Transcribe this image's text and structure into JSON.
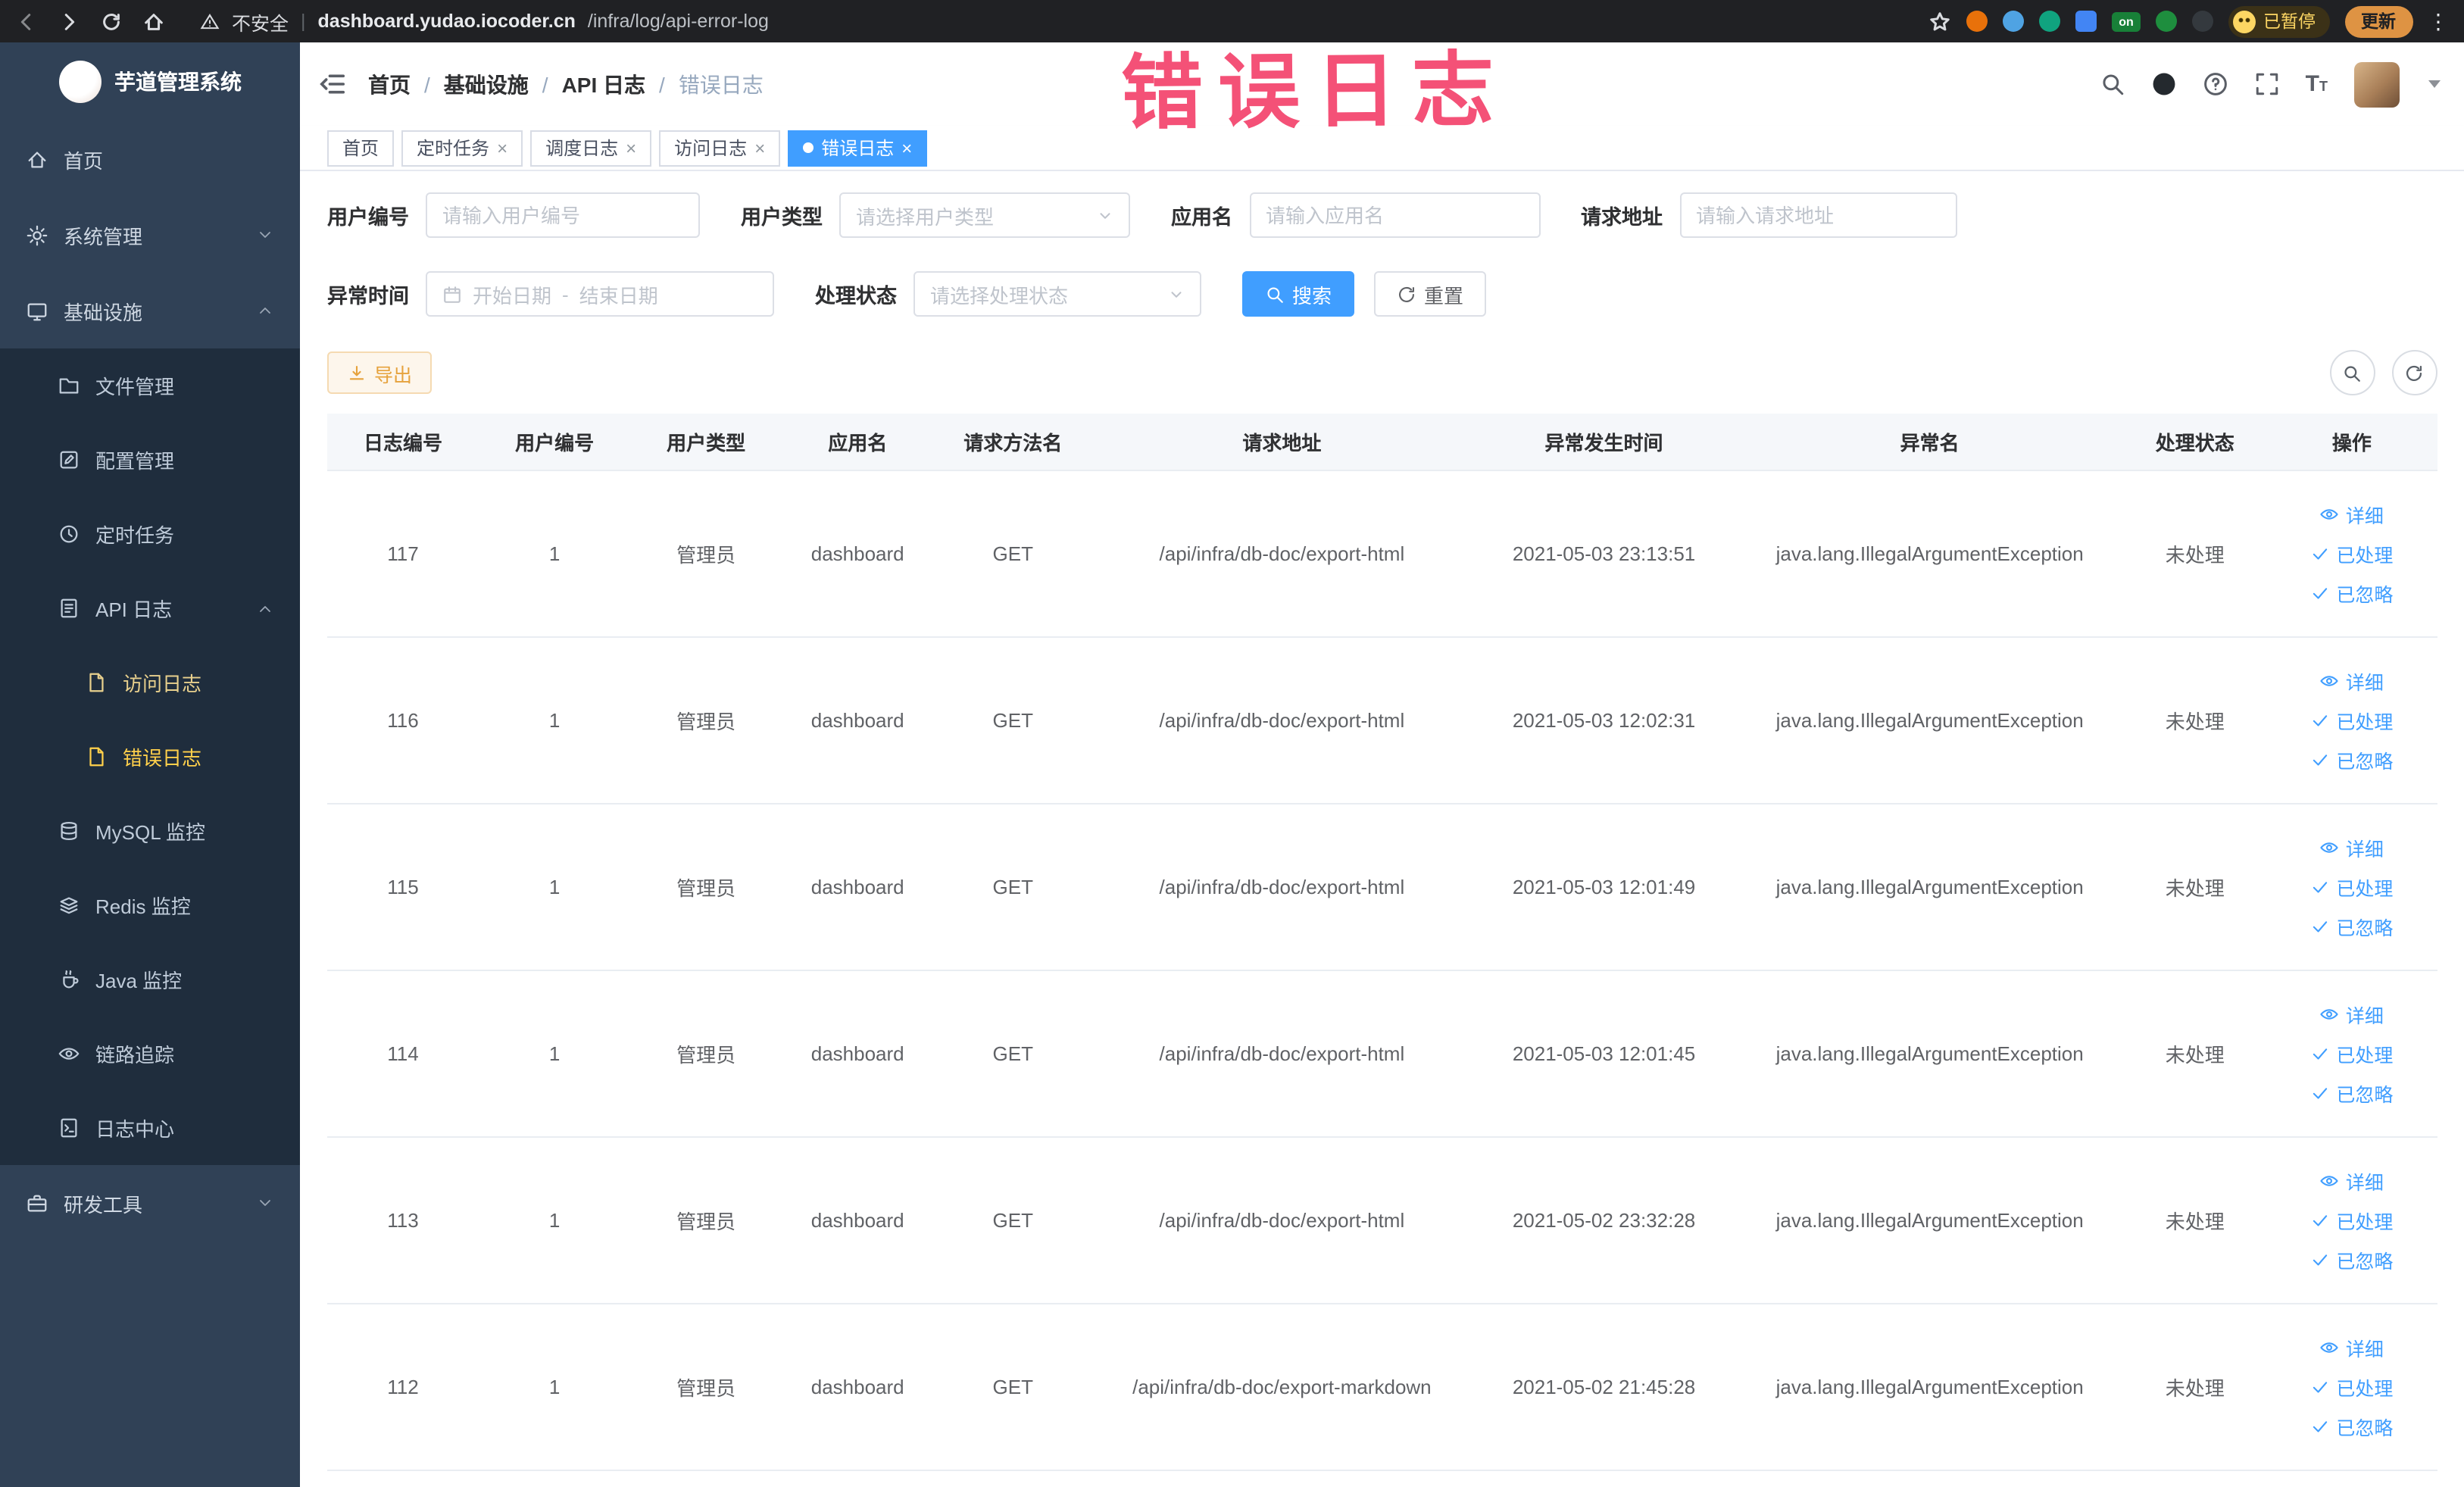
{
  "browser": {
    "security_label": "不安全",
    "url_domain": "dashboard.yudao.iocoder.cn",
    "url_path": "/infra/log/api-error-log",
    "ext_on_label": "on",
    "profile_badge": "已暂停",
    "update_label": "更新"
  },
  "annotation": {
    "text": "错误日志"
  },
  "sidebar": {
    "title": "芋道管理系统",
    "items": {
      "home": "首页",
      "system": "系统管理",
      "infra": "基础设施",
      "file": "文件管理",
      "config": "配置管理",
      "job": "定时任务",
      "api_log": "API 日志",
      "access_log": "访问日志",
      "error_log": "错误日志",
      "mysql": "MySQL 监控",
      "redis": "Redis 监控",
      "java": "Java 监控",
      "trace": "链路追踪",
      "log_center": "日志中心",
      "dev_tools": "研发工具"
    }
  },
  "breadcrumb": {
    "items": [
      "首页",
      "基础设施",
      "API 日志",
      "错误日志"
    ]
  },
  "tabs": [
    {
      "label": "首页"
    },
    {
      "label": "定时任务"
    },
    {
      "label": "调度日志"
    },
    {
      "label": "访问日志"
    },
    {
      "label": "错误日志"
    }
  ],
  "filters": {
    "user_id_label": "用户编号",
    "user_id_placeholder": "请输入用户编号",
    "user_type_label": "用户类型",
    "user_type_placeholder": "请选择用户类型",
    "app_name_label": "应用名",
    "app_name_placeholder": "请输入应用名",
    "request_url_label": "请求地址",
    "request_url_placeholder": "请输入请求地址",
    "time_label": "异常时间",
    "time_start_placeholder": "开始日期",
    "time_separator": "-",
    "time_end_placeholder": "结束日期",
    "status_label": "处理状态",
    "status_placeholder": "请选择处理状态",
    "search_label": "搜索",
    "reset_label": "重置"
  },
  "toolbar": {
    "export_label": "导出"
  },
  "table": {
    "columns": [
      "日志编号",
      "用户编号",
      "用户类型",
      "应用名",
      "请求方法名",
      "请求地址",
      "异常发生时间",
      "异常名",
      "处理状态",
      "操作"
    ],
    "action_labels": [
      "详细",
      "已处理",
      "已忽略"
    ],
    "rows": [
      {
        "id": "117",
        "user_id": "1",
        "user_type": "管理员",
        "app_name": "dashboard",
        "method": "GET",
        "url": "/api/infra/db-doc/export-html",
        "time": "2021-05-03 23:13:51",
        "exception": "java.lang.IllegalArgumentException",
        "status": "未处理"
      },
      {
        "id": "116",
        "user_id": "1",
        "user_type": "管理员",
        "app_name": "dashboard",
        "method": "GET",
        "url": "/api/infra/db-doc/export-html",
        "time": "2021-05-03 12:02:31",
        "exception": "java.lang.IllegalArgumentException",
        "status": "未处理"
      },
      {
        "id": "115",
        "user_id": "1",
        "user_type": "管理员",
        "app_name": "dashboard",
        "method": "GET",
        "url": "/api/infra/db-doc/export-html",
        "time": "2021-05-03 12:01:49",
        "exception": "java.lang.IllegalArgumentException",
        "status": "未处理"
      },
      {
        "id": "114",
        "user_id": "1",
        "user_type": "管理员",
        "app_name": "dashboard",
        "method": "GET",
        "url": "/api/infra/db-doc/export-html",
        "time": "2021-05-03 12:01:45",
        "exception": "java.lang.IllegalArgumentException",
        "status": "未处理"
      },
      {
        "id": "113",
        "user_id": "1",
        "user_type": "管理员",
        "app_name": "dashboard",
        "method": "GET",
        "url": "/api/infra/db-doc/export-html",
        "time": "2021-05-02 23:32:28",
        "exception": "java.lang.IllegalArgumentException",
        "status": "未处理"
      },
      {
        "id": "112",
        "user_id": "1",
        "user_type": "管理员",
        "app_name": "dashboard",
        "method": "GET",
        "url": "/api/infra/db-doc/export-markdown",
        "time": "2021-05-02 21:45:28",
        "exception": "java.lang.IllegalArgumentException",
        "status": "未处理"
      }
    ]
  },
  "colors": {
    "accent": "#409eff",
    "warning": "#e6a23c",
    "sidebar_active": "#ffd04b"
  }
}
